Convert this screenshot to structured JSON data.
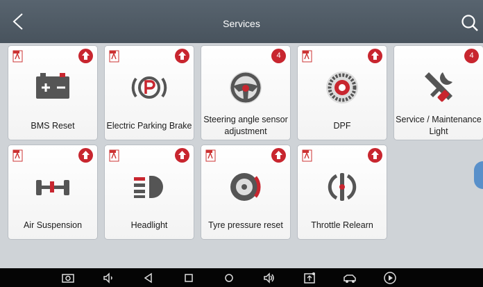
{
  "header": {
    "title": "Services",
    "back_icon": "chevron-left-icon",
    "search_icon": "search-icon"
  },
  "tiles": [
    {
      "label": "BMS Reset",
      "badge": "upload",
      "icon": "battery-icon"
    },
    {
      "label": "Electric Parking Brake",
      "badge": "upload",
      "icon": "parking-brake-icon"
    },
    {
      "label": "Steering angle sensor adjustment",
      "badge": "4",
      "icon": "steering-wheel-icon"
    },
    {
      "label": "DPF",
      "badge": "upload",
      "icon": "dpf-icon"
    },
    {
      "label": "Service / Maintenance Light",
      "badge": "4",
      "icon": "wrench-screwdriver-icon"
    },
    {
      "label": "Air Suspension",
      "badge": "upload",
      "icon": "suspension-icon"
    },
    {
      "label": "Headlight",
      "badge": "upload",
      "icon": "headlight-icon"
    },
    {
      "label": "Tyre pressure reset",
      "badge": "upload",
      "icon": "tyre-icon"
    },
    {
      "label": "Throttle Relearn",
      "badge": "upload",
      "icon": "throttle-icon"
    }
  ],
  "navbar": [
    "screenshot-icon",
    "volume-down-icon",
    "back-icon",
    "home-icon",
    "circle-icon",
    "volume-up-icon",
    "vci-icon",
    "car-icon",
    "play-icon"
  ],
  "colors": {
    "accent": "#c8262f",
    "header": "#4f5a64",
    "content_bg": "#cfd3d7"
  }
}
